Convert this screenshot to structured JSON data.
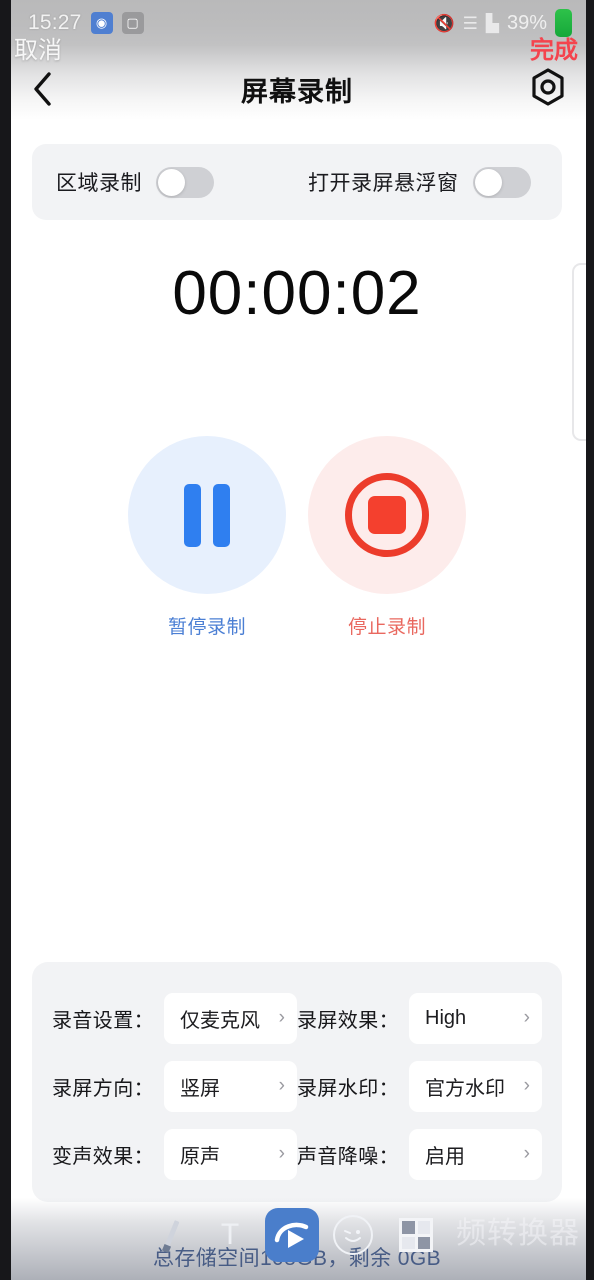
{
  "statusbar": {
    "time": "15:27",
    "icons": [
      "screen-record-icon",
      "gallery-icon"
    ],
    "mute_glyph": "mute-icon",
    "wifi_glyph": "wifi-icon",
    "signal_glyph": "signal-icon",
    "battery_percent": "39%"
  },
  "system_overlay": {
    "cancel_label": "取消",
    "done_label": "完成",
    "done_color": "#f4444e"
  },
  "navbar": {
    "back_icon": "chevron-left-icon",
    "title": "屏幕录制",
    "settings_icon": "gear-icon"
  },
  "toggles": [
    {
      "label": "区域录制",
      "state": "off",
      "name": "region-record-toggle"
    },
    {
      "label": "打开录屏悬浮窗",
      "state": "off",
      "name": "floating-window-toggle"
    }
  ],
  "timer": {
    "value": "00:00:02"
  },
  "controls": [
    {
      "name": "pause-record-button",
      "label": "暂停录制",
      "icon": "pause-icon",
      "circle_bg": "#e7f0fd",
      "icon_color": "#2f7ff0",
      "label_color": "#4b7fd4"
    },
    {
      "name": "stop-record-button",
      "label": "停止录制",
      "icon": "stop-icon",
      "circle_bg": "#fdeceb",
      "icon_color": "#ec3c2b",
      "label_color": "#e9685f"
    }
  ],
  "settings": {
    "rows": [
      [
        {
          "label": "录音设置：",
          "value": "仅麦克风",
          "name": "audio-source-setting"
        },
        {
          "label": "录屏效果：",
          "value": "High",
          "name": "record-quality-setting"
        }
      ],
      [
        {
          "label": "录屏方向：",
          "value": "竖屏",
          "name": "record-orientation-setting"
        },
        {
          "label": "录屏水印：",
          "value": "官方水印",
          "name": "record-watermark-setting"
        }
      ],
      [
        {
          "label": "变声效果：",
          "value": "原声",
          "name": "voice-changer-setting"
        },
        {
          "label": "声音降噪：",
          "value": "启用",
          "name": "noise-reduction-setting"
        }
      ]
    ]
  },
  "bottom": {
    "storage_text": "总存储空间108GB，剩余 0GB",
    "watermark_text": "频转换器",
    "overlay_icons": [
      "pencil-icon",
      "text-icon",
      "video-app-icon",
      "smiley-icon",
      "grid-icon"
    ],
    "text_glyph": "T"
  }
}
